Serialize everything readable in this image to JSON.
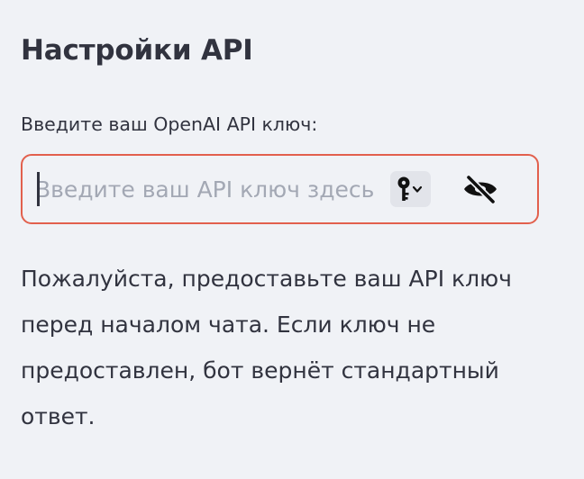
{
  "settings": {
    "title": "Настройки API",
    "api_key_label": "Введите ваш OpenAI API ключ:",
    "api_key_value": "",
    "api_key_placeholder": "Введите ваш API ключ здесь",
    "key_icon": "key-icon",
    "visibility_icon": "eye-slash-icon",
    "help_text": "Пожалуйста, предоставьте ваш API ключ перед началом чата. Если ключ не предоставлен, бот вернёт стандартный ответ."
  },
  "colors": {
    "background": "#f0f2f6",
    "text": "#31333f",
    "input_border": "#e2604d",
    "placeholder": "#a3a8b4"
  }
}
